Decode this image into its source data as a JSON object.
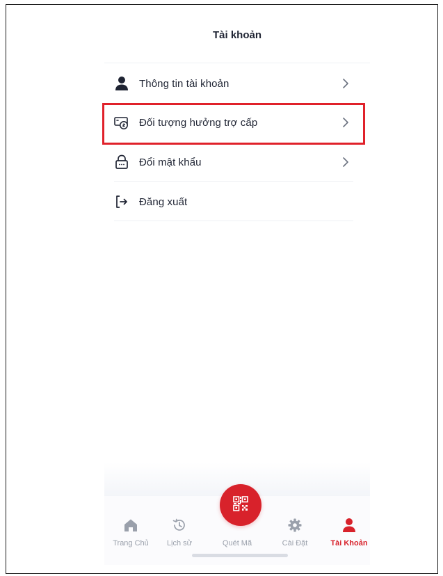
{
  "header": {
    "title": "Tài khoản"
  },
  "menu": {
    "items": [
      {
        "label": "Thông tin tài khoản",
        "icon": "user-icon",
        "chevron": true
      },
      {
        "label": "Đối tượng hưởng trợ cấp",
        "icon": "money-icon",
        "chevron": true
      },
      {
        "label": "Đổi mật khẩu",
        "icon": "lock-icon",
        "chevron": true
      },
      {
        "label": "Đăng xuất",
        "icon": "logout-icon",
        "chevron": false
      }
    ]
  },
  "tabbar": {
    "tabs": [
      {
        "label": "Trang Chủ",
        "icon": "home-icon"
      },
      {
        "label": "Lịch sử",
        "icon": "history-icon"
      },
      {
        "label": "Quét Mã",
        "icon": "qr-code-icon"
      },
      {
        "label": "Cài Đặt",
        "icon": "gear-icon"
      },
      {
        "label": "Tài Khoản",
        "icon": "user-icon",
        "active": true
      }
    ]
  },
  "colors": {
    "accent": "#d8222b",
    "text": "#1f2433",
    "muted": "#9aa0ab",
    "highlight": "#e0212a"
  }
}
